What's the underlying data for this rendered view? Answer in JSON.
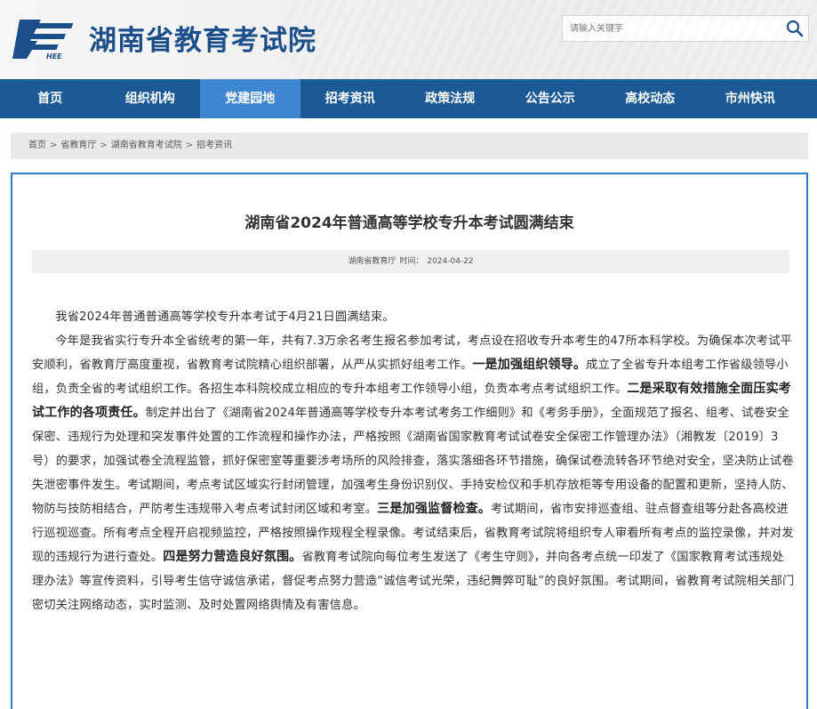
{
  "header": {
    "logo_text": "HEE",
    "site_title": "湖南省教育考试院",
    "search_placeholder": "请输入关键字"
  },
  "nav": {
    "items": [
      {
        "label": "首页",
        "active": false
      },
      {
        "label": "组织机构",
        "active": false
      },
      {
        "label": "党建园地",
        "active": true
      },
      {
        "label": "招考资讯",
        "active": false
      },
      {
        "label": "政策法规",
        "active": false
      },
      {
        "label": "公告公示",
        "active": false
      },
      {
        "label": "高校动态",
        "active": false
      },
      {
        "label": "市州快讯",
        "active": false
      }
    ]
  },
  "breadcrumb": {
    "items": [
      "首页",
      "省教育厅",
      "湖南省教育考试院",
      "招考资讯"
    ],
    "separator": ">"
  },
  "article": {
    "title": "湖南省2024年普通高等学校专升本考试圆满结束",
    "source": "湖南省教育厅",
    "time_label": "时间：",
    "date": "2024-04-22",
    "p1": "我省2024年普通普通高等学校专升本考试于4月21日圆满结束。",
    "p2": [
      {
        "t": "今年是我省实行专升本全省统考的第一年，共有7.3万余名考生报名参加考试，考点设在招收专升本考生的47所本科学校。为确保本次考试平安顺利，省教育厅高度重视，省教育考试院精心组织部署，从严从实抓好组考工作。",
        "b": false
      },
      {
        "t": "一是加强组织领导。",
        "b": true
      },
      {
        "t": "成立了全省专升本组考工作省级领导小组，负责全省的考试组织工作。各招生本科院校成立相应的专升本组考工作领导小组，负责本考点考试组织工作。",
        "b": false
      },
      {
        "t": "二是采取有效措施全面压实考试工作的各项责任。",
        "b": true
      },
      {
        "t": "制定并出台了《湖南省2024年普通高等学校专升本考试考务工作细则》和《考务手册》，全面规范了报名、组考、试卷安全保密、违规行为处理和突发事件处置的工作流程和操作办法，严格按照《湖南省国家教育考试试卷安全保密工作管理办法》（湘教发〔2019〕3号）的要求，加强试卷全流程监管，抓好保密室等重要涉考场所的风险排查，落实落细各环节措施，确保试卷流转各环节绝对安全，坚决防止试卷失泄密事件发生。考试期间，考点考试区域实行封闭管理，加强考生身份识别仪、手持安检仪和手机存放柜等专用设备的配置和更新，坚持人防、物防与技防相结合，严防考生违规带入考点考试封闭区域和考室。",
        "b": false
      },
      {
        "t": "三是加强监督检查。",
        "b": true
      },
      {
        "t": "考试期间，省市安排巡查组、驻点督查组等分赴各高校进行巡视巡查。所有考点全程开启视频监控，严格按照操作规程全程录像。考试结束后，省教育考试院将组织专人审看所有考点的监控录像，并对发现的违规行为进行查处。",
        "b": false
      },
      {
        "t": "四是努力营造良好氛围。",
        "b": true
      },
      {
        "t": "省教育考试院向每位考生发送了《考生守则》，并向各考点统一印发了《国家教育考试违规处理办法》等宣传资料，引导考生信守诚信承诺，督促考点努力营造“诚信考试光荣，违纪舞弊可耻”的良好氛围。考试期间，省教育考试院相关部门密切关注网络动态，实时监测、及时处置网络舆情及有害信息。",
        "b": false
      }
    ]
  },
  "colors": {
    "brand_blue": "#1c4f8a",
    "nav_bg": "#1c5a96",
    "nav_active": "#3f86d0",
    "article_border": "#2f7ac9"
  },
  "icons": {
    "logo": "hee-logo-icon",
    "search": "search-icon"
  }
}
